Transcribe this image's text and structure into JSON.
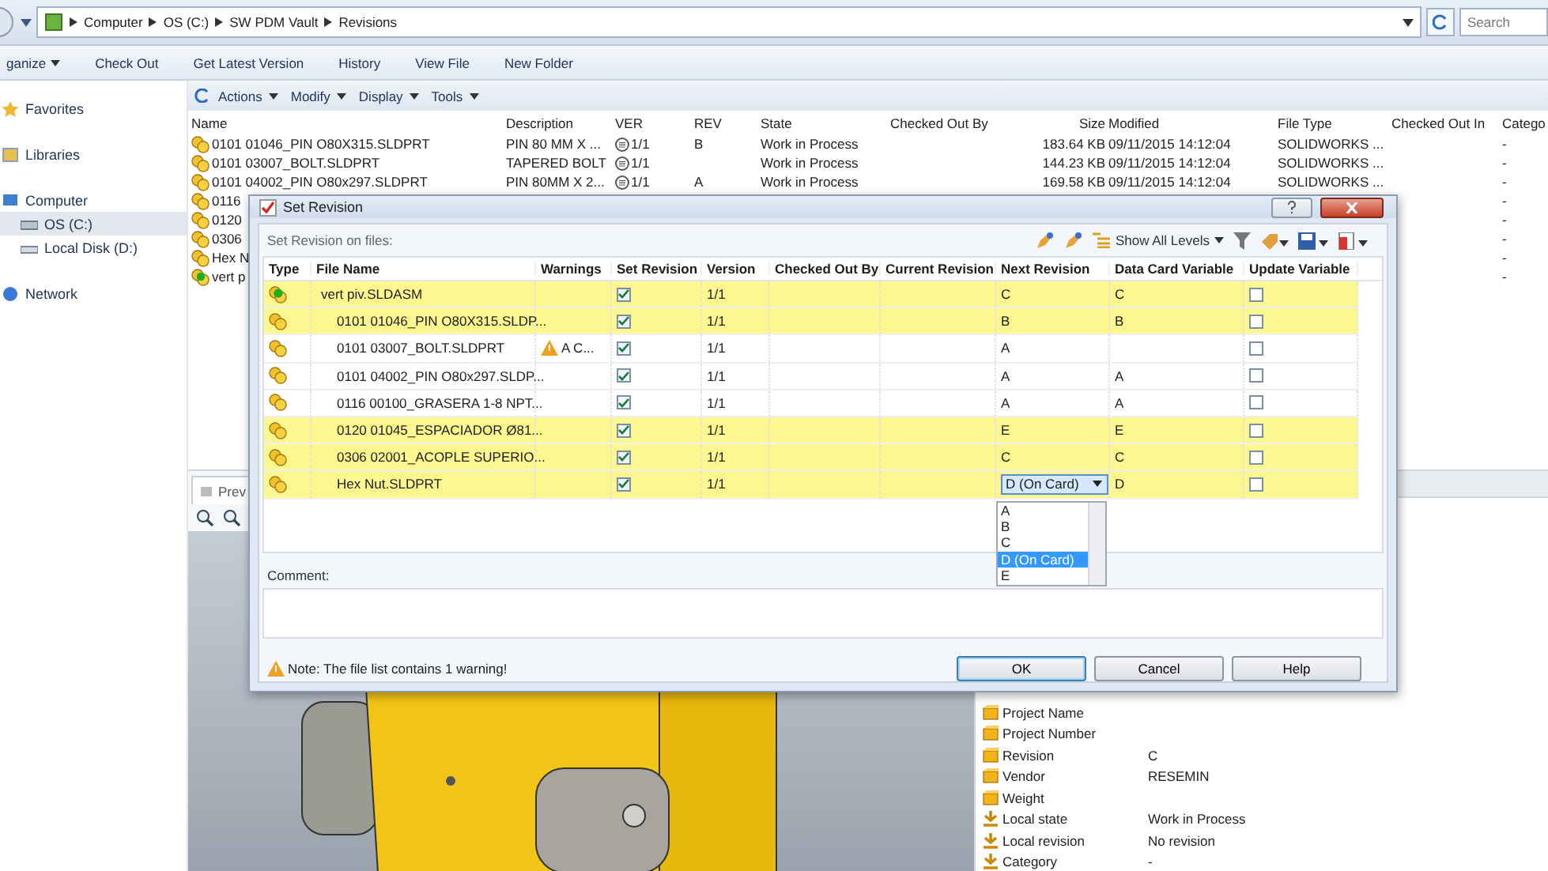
{
  "address_bar": {
    "path": [
      "Computer",
      "OS (C:)",
      "SW PDM Vault",
      "Revisions"
    ],
    "search_placeholder": "Search"
  },
  "command_bar": [
    {
      "label": "ganize",
      "dropdown": true
    },
    {
      "label": "Check Out",
      "dropdown": false
    },
    {
      "label": "Get Latest Version",
      "dropdown": false
    },
    {
      "label": "History",
      "dropdown": false
    },
    {
      "label": "View File",
      "dropdown": false
    },
    {
      "label": "New Folder",
      "dropdown": false
    }
  ],
  "sidebar": {
    "items": [
      {
        "label": "Favorites",
        "kind": "favorites",
        "selected": false
      },
      {
        "label": "Libraries",
        "kind": "libraries",
        "selected": false
      },
      {
        "label": "Computer",
        "kind": "computer",
        "selected": false,
        "children": [
          {
            "label": "OS (C:)",
            "kind": "drive",
            "selected": true
          },
          {
            "label": "Local Disk (D:)",
            "kind": "disk",
            "selected": false
          }
        ]
      },
      {
        "label": "Network",
        "kind": "network",
        "selected": false
      }
    ]
  },
  "file_toolbar": [
    "Actions",
    "Modify",
    "Display",
    "Tools"
  ],
  "file_list": {
    "columns": [
      "Name",
      "Description",
      "VER",
      "REV",
      "State",
      "Checked Out By",
      "Size",
      "Modified",
      "File Type",
      "Checked Out In",
      "Catego"
    ],
    "rows": [
      {
        "kind": "part",
        "name": "0101 01046_PIN O80X315.SLDPRT",
        "description": "PIN 80 MM X ...",
        "ver": "1/1",
        "rev": "B",
        "state": "Work in Process",
        "size": "183.64 KB",
        "modified": "09/11/2015 14:12:04",
        "file_type": "SOLIDWORKS ...",
        "category": "-"
      },
      {
        "kind": "part",
        "name": "0101 03007_BOLT.SLDPRT",
        "description": "TAPERED BOLT",
        "ver": "1/1",
        "state": "Work in Process",
        "size": "144.23 KB",
        "modified": "09/11/2015 14:12:04",
        "file_type": "SOLIDWORKS ...",
        "category": "-"
      },
      {
        "kind": "part",
        "name": "0101 04002_PIN O80x297.SLDPRT",
        "description": "PIN 80MM X 2...",
        "ver": "1/1",
        "rev": "A",
        "state": "Work in Process",
        "size": "169.58 KB",
        "modified": "09/11/2015 14:12:04",
        "file_type": "SOLIDWORKS ...",
        "category": "-"
      },
      {
        "kind": "part",
        "name": "0116",
        "category": "-"
      },
      {
        "kind": "part",
        "name": "0120",
        "category": "-"
      },
      {
        "kind": "part",
        "name": "0306",
        "category": "-"
      },
      {
        "kind": "part",
        "name": "Hex N",
        "category": "-"
      },
      {
        "kind": "assembly",
        "name": "vert p",
        "category": "-"
      }
    ]
  },
  "preview": {
    "tab": "Prev"
  },
  "data_card": {
    "rows": [
      {
        "kind": "variable",
        "label": "Project Name"
      },
      {
        "kind": "variable",
        "label": "Project Number"
      },
      {
        "kind": "variable",
        "label": "Revision",
        "value": "C"
      },
      {
        "kind": "variable",
        "label": "Vendor",
        "value": "RESEMIN"
      },
      {
        "kind": "variable",
        "label": "Weight"
      },
      {
        "kind": "system",
        "label": "Local state",
        "value": "Work in Process"
      },
      {
        "kind": "system",
        "label": "Local revision",
        "value": "No revision"
      },
      {
        "kind": "system",
        "label": "Category",
        "value": "-"
      }
    ]
  },
  "dialog": {
    "title": "Set Revision",
    "subtitle": "Set Revision on files:",
    "levels_button": "Show All Levels",
    "columns": [
      "Type",
      "File Name",
      "Warnings",
      "Set Revision",
      "Version",
      "Checked Out By",
      "Current Revision",
      "Next Revision",
      "Data Card Variable",
      "Update Variable"
    ],
    "files": [
      {
        "kind": "assembly",
        "file_name": "vert piv.SLDASM",
        "highlighted": true,
        "set_revision": true,
        "version": "1/1",
        "next_revision": "C",
        "data_card_variable": "C",
        "update_variable": false,
        "children": [
          {
            "kind": "part",
            "file_name": "0101 01046_PIN O80X315.SLDP...",
            "highlighted": true,
            "set_revision": true,
            "version": "1/1",
            "next_revision": "B",
            "data_card_variable": "B",
            "update_variable": false
          },
          {
            "kind": "part",
            "file_name": "0101 03007_BOLT.SLDPRT",
            "warning": "A C...",
            "highlighted": false,
            "set_revision": true,
            "version": "1/1",
            "next_revision": "A",
            "update_variable": false
          },
          {
            "kind": "part",
            "file_name": "0101 04002_PIN O80x297.SLDP...",
            "highlighted": false,
            "set_revision": true,
            "version": "1/1",
            "next_revision": "A",
            "data_card_variable": "A",
            "update_variable": false
          },
          {
            "kind": "part",
            "file_name": "0116 00100_GRASERA 1-8 NPT...",
            "highlighted": false,
            "set_revision": true,
            "version": "1/1",
            "next_revision": "A",
            "data_card_variable": "A",
            "update_variable": false
          },
          {
            "kind": "part",
            "file_name": "0120 01045_ESPACIADOR Ø81...",
            "highlighted": true,
            "set_revision": true,
            "version": "1/1",
            "next_revision": "E",
            "data_card_variable": "E",
            "update_variable": false
          },
          {
            "kind": "part",
            "file_name": "0306 02001_ACOPLE SUPERIO...",
            "highlighted": true,
            "set_revision": true,
            "version": "1/1",
            "next_revision": "C",
            "data_card_variable": "C",
            "update_variable": false
          },
          {
            "kind": "part",
            "file_name": "Hex Nut.SLDPRT",
            "highlighted": true,
            "set_revision": true,
            "version": "1/1",
            "next_revision": "D (On Card)",
            "data_card_variable": "D",
            "update_variable": false,
            "dropdown_options": [
              {
                "label": "A",
                "selected": false
              },
              {
                "label": "B",
                "selected": false
              },
              {
                "label": "C",
                "selected": false
              },
              {
                "label": "D (On Card)",
                "selected": true
              },
              {
                "label": "E",
                "selected": false
              }
            ]
          }
        ]
      }
    ],
    "comment_label": "Comment:",
    "note": "Note: The file list contains 1 warning!",
    "buttons": [
      {
        "label": "OK",
        "default": true
      },
      {
        "label": "Cancel",
        "default": false
      },
      {
        "label": "Help",
        "default": false
      }
    ]
  }
}
